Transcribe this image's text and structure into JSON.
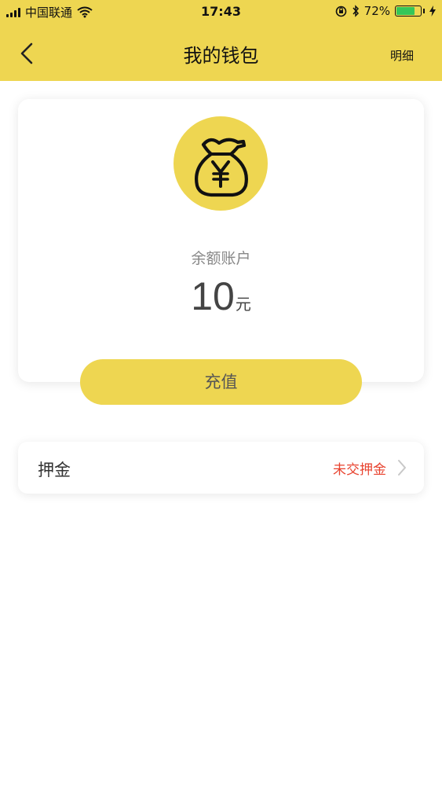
{
  "status_bar": {
    "carrier": "中国联通",
    "time": "17:43",
    "battery_percent": "72%",
    "icons": [
      "signal-icon",
      "wifi-icon",
      "orientation-lock-icon",
      "bluetooth-icon",
      "battery-icon",
      "charging-icon"
    ]
  },
  "nav": {
    "title": "我的钱包",
    "detail_label": "明细"
  },
  "wallet": {
    "icon": "money-bag-icon",
    "balance_label": "余额账户",
    "balance_amount": "10",
    "balance_unit": "元",
    "recharge_label": "充值"
  },
  "deposit": {
    "label": "押金",
    "status": "未交押金",
    "status_color": "#E8432F"
  },
  "colors": {
    "accent": "#EED651",
    "battery_green": "#35C659"
  }
}
